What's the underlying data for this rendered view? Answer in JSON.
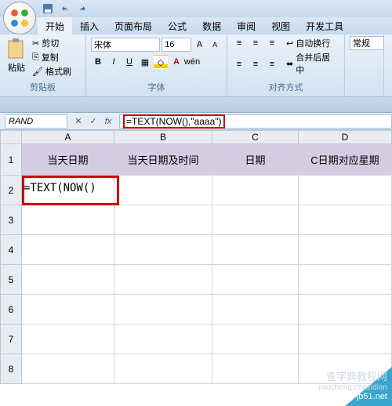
{
  "tabs": {
    "t0": "开始",
    "t1": "插入",
    "t2": "页面布局",
    "t3": "公式",
    "t4": "数据",
    "t5": "审阅",
    "t6": "视图",
    "t7": "开发工具"
  },
  "clipboard": {
    "cut": "剪切",
    "copy": "复制",
    "format": "格式刷",
    "paste": "粘贴",
    "group": "剪贴板"
  },
  "font": {
    "name": "宋体",
    "size": "16",
    "group": "字体"
  },
  "align": {
    "wrap": "自动换行",
    "merge": "合并后居中",
    "group": "对齐方式",
    "general": "常规"
  },
  "namebox": "RAND",
  "formula_display": "=TEXT(NOW(),\"aaaa\")",
  "cols": {
    "A": "A",
    "B": "B",
    "C": "C",
    "D": "D"
  },
  "rows": {
    "r1": "1",
    "r2": "2",
    "r3": "3",
    "r4": "4",
    "r5": "5",
    "r6": "6",
    "r7": "7",
    "r8": "8"
  },
  "header_cells": {
    "A1": "当天日期",
    "B1": "当天日期及时间",
    "C1": "日期",
    "D1": "C日期对应星期"
  },
  "editing_cell": "=TEXT(NOW()",
  "watermark": {
    "l1": "查字典教程网",
    "l2": "jiaocheng.chazidian",
    "l3": "jb51.net"
  },
  "colw": {
    "A": 118,
    "B": 125,
    "C": 110,
    "D": 119
  },
  "rowh": {
    "hdr": 40,
    "norm": 38
  }
}
